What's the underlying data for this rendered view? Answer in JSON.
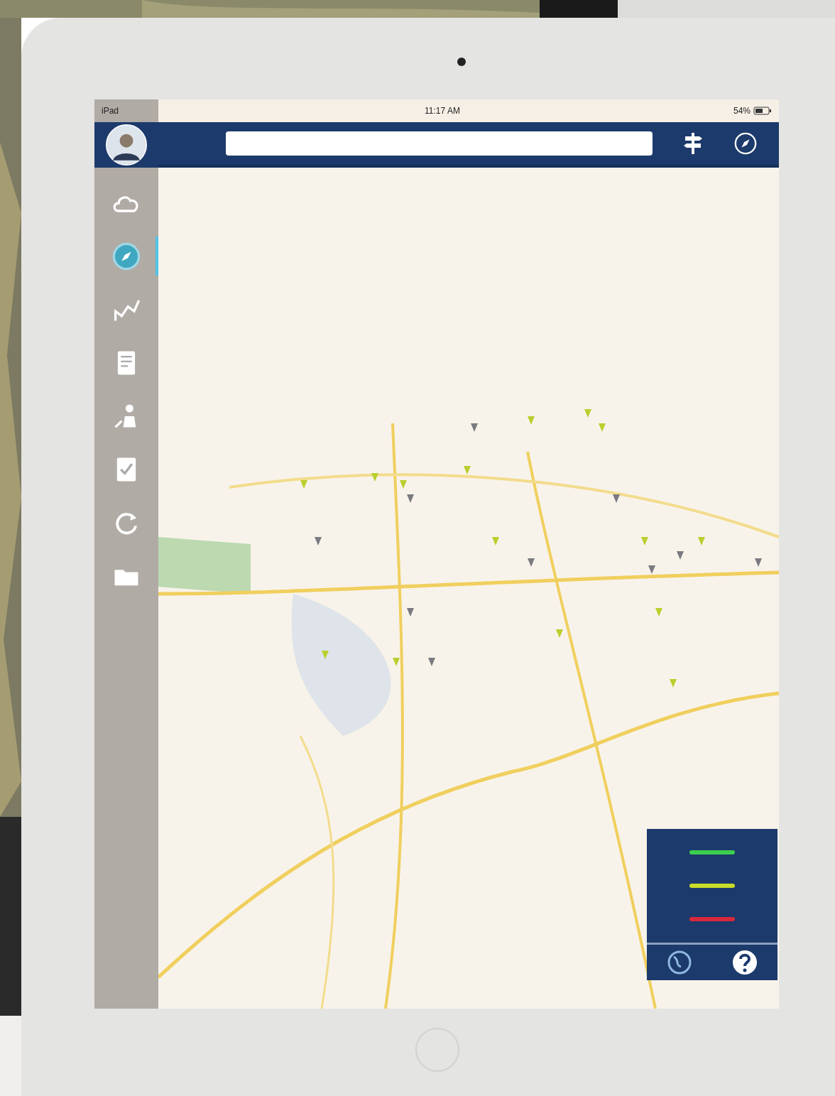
{
  "status_bar": {
    "carrier": "iPad",
    "time": "11:17 AM",
    "battery": "54%"
  },
  "sidebar": {
    "items": [
      {
        "kind": "cloud",
        "selected": false
      },
      {
        "kind": "compass",
        "selected": true
      },
      {
        "kind": "chart",
        "selected": false
      },
      {
        "kind": "document",
        "selected": false
      },
      {
        "kind": "person",
        "selected": false
      },
      {
        "kind": "checklist",
        "selected": false
      },
      {
        "kind": "refresh",
        "selected": false
      },
      {
        "kind": "folder",
        "selected": false
      }
    ]
  },
  "legend": {
    "items": [
      {
        "color": "#3ccf4e"
      },
      {
        "color": "#c8dc2a"
      },
      {
        "color": "#d8283c"
      }
    ]
  }
}
